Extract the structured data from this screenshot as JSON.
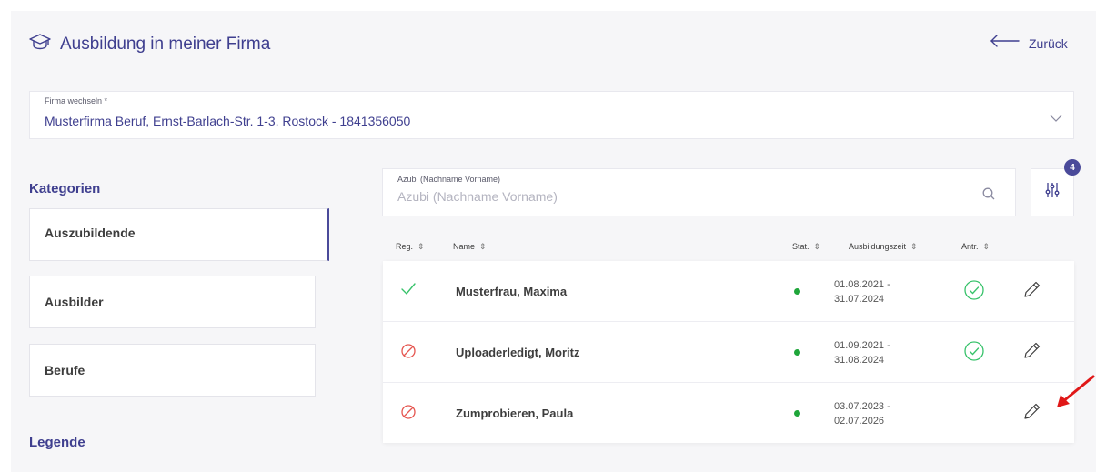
{
  "header": {
    "title": "Ausbildung in meiner Firma",
    "back_label": "Zurück"
  },
  "firm": {
    "label": "Firma wechseln *",
    "value": "Musterfirma Beruf, Ernst-Barlach-Str. 1-3, Rostock - 1841356050"
  },
  "sidebar": {
    "heading": "Kategorien",
    "items": [
      {
        "label": "Auszubildende"
      },
      {
        "label": "Ausbilder"
      },
      {
        "label": "Berufe"
      }
    ],
    "legend_heading": "Legende"
  },
  "search": {
    "label": "Azubi (Nachname Vorname)",
    "placeholder": "Azubi (Nachname Vorname)"
  },
  "filter": {
    "badge": "4"
  },
  "table": {
    "columns": {
      "reg": "Reg.",
      "name": "Name",
      "stat": "Stat.",
      "period": "Ausbildungszeit",
      "antr": "Antr."
    },
    "rows": [
      {
        "reg": "check",
        "name": "Musterfrau, Maxima",
        "status": "active",
        "period_start": "01.08.2021 -",
        "period_end": "31.07.2024",
        "antr": "check-circle"
      },
      {
        "reg": "blocked",
        "name": "Uploaderledigt, Moritz",
        "status": "active",
        "period_start": "01.09.2021 -",
        "period_end": "31.08.2024",
        "antr": "check-circle"
      },
      {
        "reg": "blocked",
        "name": "Zumprobieren, Paula",
        "status": "active",
        "period_start": "03.07.2023 -",
        "period_end": "02.07.2026",
        "antr": ""
      }
    ]
  },
  "colors": {
    "accent": "#3f3f8f",
    "badge": "#4a4a9a",
    "success": "#37c26a",
    "danger": "#e5554f",
    "status_dot": "#1fa63a",
    "annotation": "#e01818"
  }
}
